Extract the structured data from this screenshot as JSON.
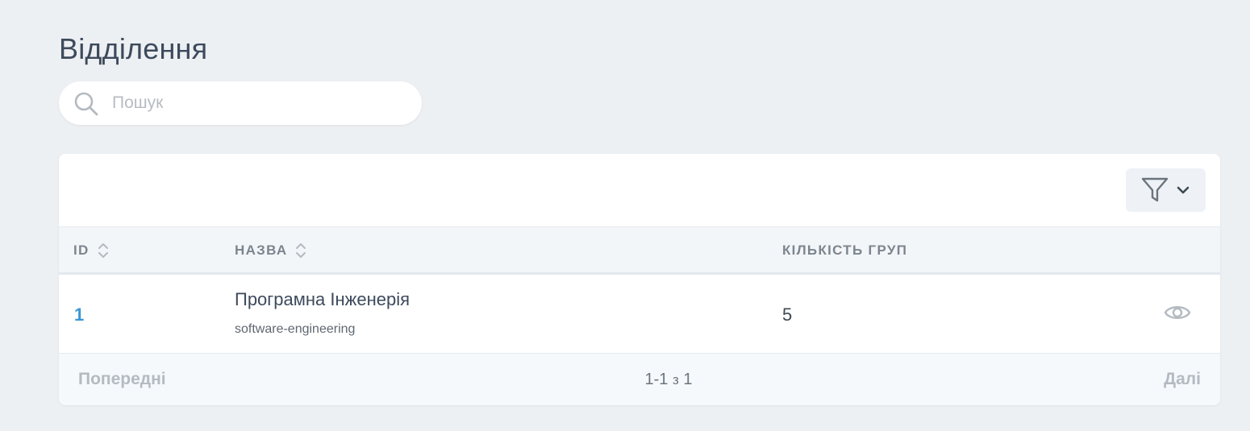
{
  "page": {
    "title": "Відділення"
  },
  "search": {
    "placeholder": "Пошук",
    "value": ""
  },
  "toolbar": {
    "filter_icon": "filter-icon",
    "dropdown_icon": "chevron-down-icon"
  },
  "table": {
    "columns": [
      {
        "key": "id",
        "label": "ID",
        "sortable": true
      },
      {
        "key": "name",
        "label": "Назва",
        "sortable": true
      },
      {
        "key": "groups",
        "label": "Кількість груп",
        "sortable": false
      }
    ],
    "rows": [
      {
        "id": "1",
        "name": "Програмна Інженерія",
        "slug": "software-engineering",
        "groups": "5",
        "action_icon": "eye-icon"
      }
    ]
  },
  "pagination": {
    "prev": "Попередні",
    "range": "1-1",
    "separator": "з",
    "total": "1",
    "next": "Далі"
  },
  "colors": {
    "accent": "#3a97d4",
    "background": "#edf0f3",
    "header_bg": "#f3f6f9",
    "pager_bg": "#f5f9fc"
  }
}
